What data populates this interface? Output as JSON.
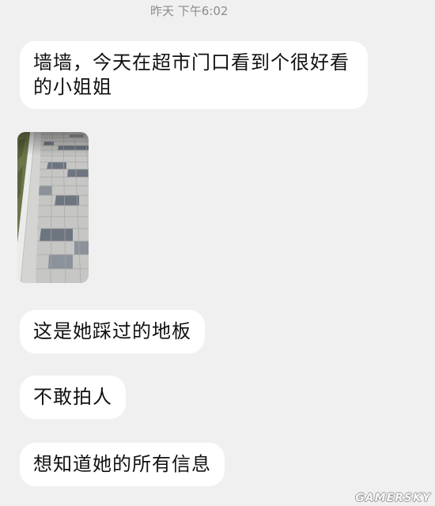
{
  "status": {
    "timestamp": "昨天 下午6:02"
  },
  "messages": [
    {
      "text": "墙墙，今天在超市门口看到个很好看的小姐姐"
    },
    {
      "photo": {
        "grass": "#6b7548",
        "grass_dark": "#58623a",
        "curb": "#ebebea",
        "gutter": "#d4d4d2",
        "paver": "#c6c6c4",
        "paver_joint": "#a8a8a6",
        "dark_tile": "#6d7580",
        "mid_tile": "#8b929a"
      }
    },
    {
      "text": "这是她踩过的地板"
    },
    {
      "text": "不敢拍人"
    },
    {
      "text": "想知道她的所有信息"
    }
  ],
  "watermark": "GAMERSKY",
  "colors": {
    "background": "#f0f0f0",
    "bubble": "#ffffff",
    "text": "#111111",
    "timestamp": "#8c8c8c"
  }
}
